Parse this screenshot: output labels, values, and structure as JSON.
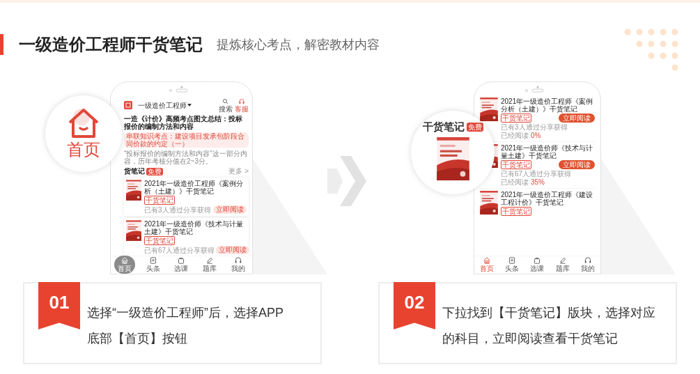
{
  "header": {
    "title": "一级造价工程师干货笔记",
    "subtitle": "提炼核心考点，解密教材内容"
  },
  "left_phone": {
    "app_title": "一级造价工程师",
    "header_actions": [
      {
        "kind": "search",
        "label": "搜索"
      },
      {
        "kind": "service",
        "label": "客服"
      }
    ],
    "article": {
      "title": "一造《计价》高频考点图文总结：投标报价的编制方法和内容",
      "highlight": "串联知识考点：建设项目发承包阶段合同价款的约定（一）",
      "summary": "“投标报价的编制方法和内容”这一部分内容，历年考核分值在2~3分。"
    },
    "section": {
      "title": "货笔记",
      "badge": "免费",
      "more": "更多 >"
    },
    "notes": [
      {
        "title": "2021年一级造价工程师《案例分析（土建）》干货笔记",
        "tag": "干货笔记",
        "stats": "已有3人通过分享获得",
        "button": "立即阅读"
      },
      {
        "title": "2021年一级造价师《技术与计量土建》干货笔记",
        "tag": "干货笔记",
        "stats": "已有67人通过分享获得",
        "button": "立即阅读"
      }
    ],
    "nav": [
      {
        "kind": "home",
        "label": "首页",
        "selected": true
      },
      {
        "kind": "news",
        "label": "头条",
        "selected": false
      },
      {
        "kind": "course",
        "label": "选课",
        "selected": false
      },
      {
        "kind": "quiz",
        "label": "题库",
        "selected": false
      },
      {
        "kind": "me",
        "label": "我的",
        "selected": false
      }
    ]
  },
  "left_magnifier": {
    "label": "首页"
  },
  "right_magnifier": {
    "title": "干货笔记",
    "badge": "免费"
  },
  "right_phone": {
    "notes": [
      {
        "title": "2021年一级造价工程师《案例分析（土建）》干货笔记",
        "tag": "干货笔记",
        "stats": "已有3人通过分享获得",
        "progress_label": "已经阅读",
        "progress": "0%",
        "button": "立即阅读"
      },
      {
        "title": "2021年一级造价师《技术与计量土建》干货笔记",
        "tag": "干货笔记",
        "stats": "已有67人通过分享获得",
        "progress_label": "已经阅读",
        "progress": "35%",
        "button": "立即阅读"
      },
      {
        "title": "2021年一级造价工程师《建设工程计价》干货笔记",
        "tag": "干货笔记"
      }
    ],
    "nav": [
      {
        "kind": "home",
        "label": "首页",
        "selected": true
      },
      {
        "kind": "news",
        "label": "头条",
        "selected": false
      },
      {
        "kind": "course",
        "label": "选课",
        "selected": false
      },
      {
        "kind": "quiz",
        "label": "题库",
        "selected": false
      },
      {
        "kind": "me",
        "label": "我的",
        "selected": false
      }
    ]
  },
  "steps": [
    {
      "number": "01",
      "lines": [
        "选择“一级造价工程师”后，选择APP",
        "底部【首页】按钮"
      ]
    },
    {
      "number": "02",
      "lines": [
        "下拉找到【干货笔记】版块，选择对应",
        "的科目，立即阅读查看干货笔记"
      ]
    }
  ]
}
